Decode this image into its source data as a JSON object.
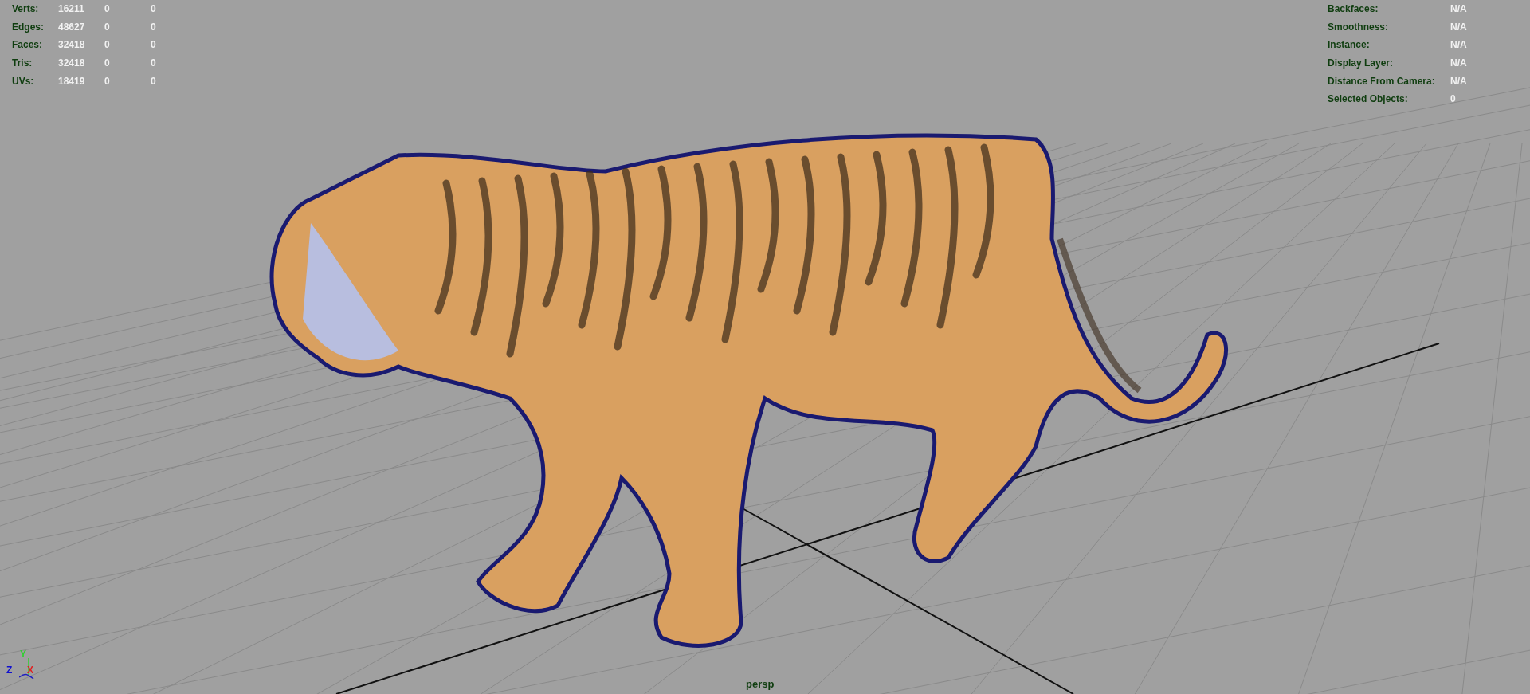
{
  "stats": [
    {
      "label": "Verts:",
      "values": [
        "16211",
        "0",
        "0"
      ]
    },
    {
      "label": "Edges:",
      "values": [
        "48627",
        "0",
        "0"
      ]
    },
    {
      "label": "Faces:",
      "values": [
        "32418",
        "0",
        "0"
      ]
    },
    {
      "label": "Tris:",
      "values": [
        "32418",
        "0",
        "0"
      ]
    },
    {
      "label": "UVs:",
      "values": [
        "18419",
        "0",
        "0"
      ]
    }
  ],
  "info": [
    {
      "label": "Backfaces:",
      "value": "N/A"
    },
    {
      "label": "Smoothness:",
      "value": "N/A"
    },
    {
      "label": "Instance:",
      "value": "N/A"
    },
    {
      "label": "Display Layer:",
      "value": "N/A"
    },
    {
      "label": "Distance From Camera:",
      "value": "N/A"
    },
    {
      "label": "Selected Objects:",
      "value": "0"
    }
  ],
  "camera": "persp",
  "axis_gizmo": {
    "y": "Y",
    "z": "Z",
    "x": "X"
  }
}
